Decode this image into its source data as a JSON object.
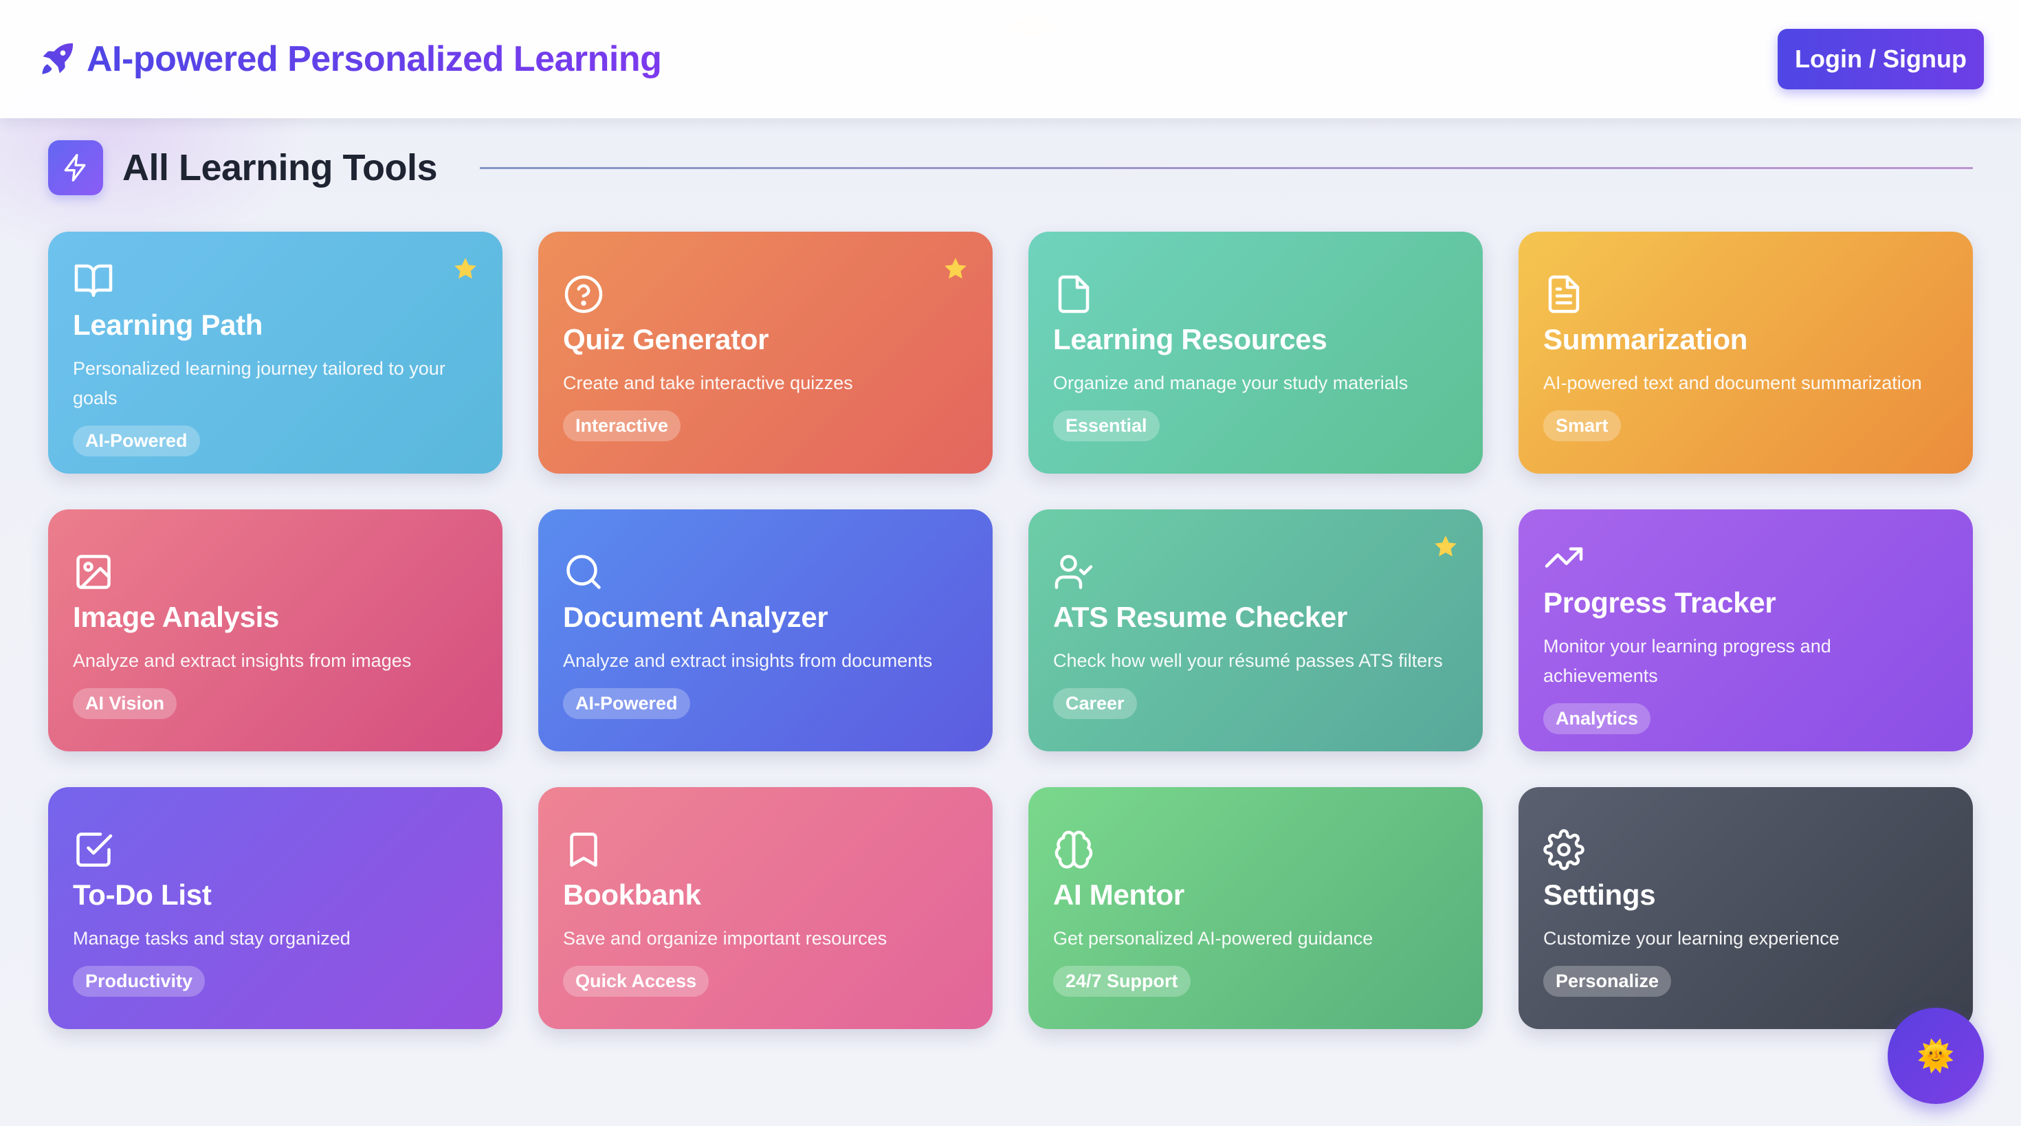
{
  "header": {
    "title": "AI-powered Personalized Learning",
    "login_label": "Login / Signup",
    "brand_icon": "rocket-icon"
  },
  "section": {
    "title": "All Learning Tools",
    "icon": "lightning-icon"
  },
  "cards": [
    {
      "title": "Learning Path",
      "desc": "Personalized learning journey tailored to your goals",
      "badge": "AI-Powered",
      "icon": "book-open-icon",
      "starred": true,
      "gradient": [
        "#6ec2ee",
        "#5ab8dc"
      ]
    },
    {
      "title": "Quiz Generator",
      "desc": "Create and take interactive quizzes",
      "badge": "Interactive",
      "icon": "help-circle-icon",
      "starred": true,
      "gradient": [
        "#ee8f5a",
        "#e3665e"
      ]
    },
    {
      "title": "Learning Resources",
      "desc": "Organize and manage your study materials",
      "badge": "Essential",
      "icon": "file-icon",
      "starred": false,
      "gradient": [
        "#6fd3bd",
        "#5ec094"
      ]
    },
    {
      "title": "Summarization",
      "desc": "AI-powered text and document summarization",
      "badge": "Smart",
      "icon": "file-text-icon",
      "starred": false,
      "gradient": [
        "#f5c550",
        "#eb8d3c"
      ]
    },
    {
      "title": "Image Analysis",
      "desc": "Analyze and extract insights from images",
      "badge": "AI Vision",
      "icon": "image-icon",
      "starred": false,
      "gradient": [
        "#ec7e8c",
        "#d44e80"
      ]
    },
    {
      "title": "Document Analyzer",
      "desc": "Analyze and extract insights from documents",
      "badge": "AI-Powered",
      "icon": "search-icon",
      "starred": false,
      "gradient": [
        "#5a8cef",
        "#5c5ce0"
      ]
    },
    {
      "title": "ATS Resume Checker",
      "desc": "Check how well your résumé passes ATS filters",
      "badge": "Career",
      "icon": "user-check-icon",
      "starred": true,
      "gradient": [
        "#6dcda8",
        "#58a89a"
      ]
    },
    {
      "title": "Progress Tracker",
      "desc": "Monitor your learning progress and achievements",
      "badge": "Analytics",
      "icon": "trending-up-icon",
      "starred": false,
      "gradient": [
        "#a866ec",
        "#8b4fe6"
      ]
    },
    {
      "title": "To-Do List",
      "desc": "Manage tasks and stay organized",
      "badge": "Productivity",
      "icon": "check-square-icon",
      "starred": false,
      "gradient": [
        "#7565ec",
        "#9450e0"
      ]
    },
    {
      "title": "Bookbank",
      "desc": "Save and organize important resources",
      "badge": "Quick Access",
      "icon": "bookmark-icon",
      "starred": false,
      "gradient": [
        "#ee8494",
        "#e26599"
      ]
    },
    {
      "title": "AI Mentor",
      "desc": "Get personalized AI-powered guidance",
      "badge": "24/7 Support",
      "icon": "brain-icon",
      "starred": false,
      "gradient": [
        "#7ad88c",
        "#58b07c"
      ]
    },
    {
      "title": "Settings",
      "desc": "Customize your learning experience",
      "badge": "Personalize",
      "icon": "gear-icon",
      "starred": false,
      "gradient": [
        "#5a6070",
        "#3c414c"
      ]
    }
  ],
  "fab": {
    "glyph": "🌞",
    "icon": "chat-assistant-icon"
  }
}
